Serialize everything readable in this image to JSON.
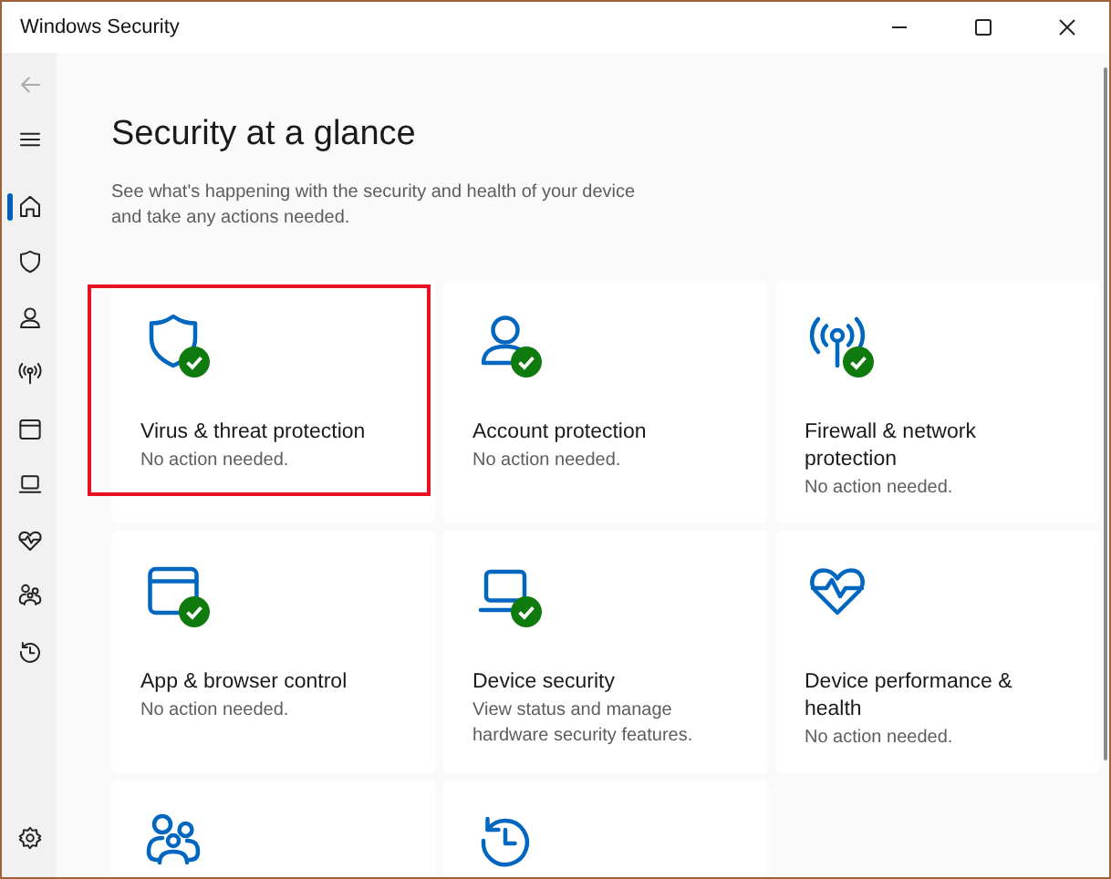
{
  "window": {
    "title": "Windows Security"
  },
  "sidebar": {
    "top": [
      {
        "kind": "back",
        "disabled": true
      },
      {
        "kind": "menu",
        "disabled": false
      }
    ],
    "items": [
      {
        "kind": "home",
        "selected": true
      },
      {
        "kind": "shield",
        "selected": false
      },
      {
        "kind": "person",
        "selected": false
      },
      {
        "kind": "antenna",
        "selected": false
      },
      {
        "kind": "browser",
        "selected": false
      },
      {
        "kind": "laptop",
        "selected": false
      },
      {
        "kind": "heart",
        "selected": false
      },
      {
        "kind": "family",
        "selected": false
      },
      {
        "kind": "history",
        "selected": false
      }
    ],
    "bottom": [
      {
        "kind": "settings",
        "selected": false
      }
    ]
  },
  "page": {
    "title": "Security at a glance",
    "subtitle": "See what's happening with the security and health of your device and take any actions needed."
  },
  "cards": [
    {
      "kind": "shield",
      "title": "Virus & threat protection",
      "status": "No action needed.",
      "ok": true,
      "highlighted": true
    },
    {
      "kind": "person",
      "title": "Account protection",
      "status": "No action needed.",
      "ok": true
    },
    {
      "kind": "antenna",
      "title": "Firewall & network protection",
      "status": "No action needed.",
      "ok": true
    },
    {
      "kind": "browser",
      "title": "App & browser control",
      "status": "No action needed.",
      "ok": true
    },
    {
      "kind": "laptop",
      "title": "Device security",
      "status": "View status and manage hardware security features.",
      "ok": true
    },
    {
      "kind": "heart",
      "title": "Device performance & health",
      "status": "No action needed."
    },
    {
      "kind": "family"
    },
    {
      "kind": "history"
    }
  ]
}
